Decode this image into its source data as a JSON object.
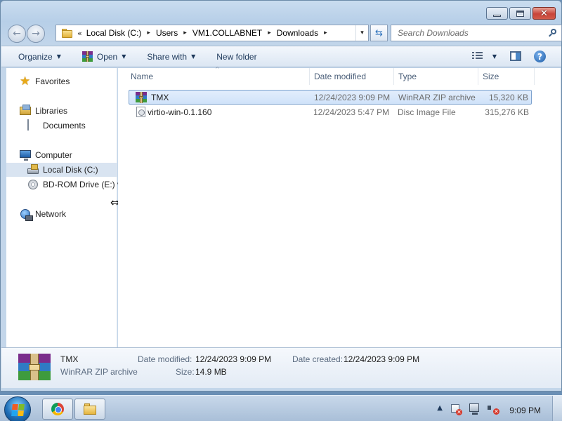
{
  "window": {
    "close_glyph": "✕"
  },
  "address": {
    "chevrons": "«",
    "crumbs": [
      "Local Disk (C:)",
      "Users",
      "VM1.COLLABNET",
      "Downloads"
    ],
    "sep": "▸",
    "dropdown": "▾",
    "refresh": "⇆",
    "search_placeholder": "Search Downloads"
  },
  "nav_buttons": {
    "back": "←",
    "forward": "→"
  },
  "commands": {
    "organize": "Organize",
    "open": "Open",
    "share_with": "Share with",
    "new_folder": "New folder",
    "dropdown_arrow": "▼",
    "help": "?"
  },
  "nav_pane": {
    "favorites": "Favorites",
    "libraries": "Libraries",
    "documents": "Documents",
    "computer": "Computer",
    "local_disk": "Local Disk (C:)",
    "bd_rom": "BD-ROM Drive (E:) v",
    "network": "Network",
    "star_glyph": "★",
    "resize_cursor": "⇔"
  },
  "columns": {
    "name": "Name",
    "date_modified": "Date modified",
    "type": "Type",
    "size": "Size",
    "sort_caret": "^"
  },
  "files": [
    {
      "name": "TMX",
      "date": "12/24/2023 9:09 PM",
      "type": "WinRAR ZIP archive",
      "size": "15,320 KB",
      "icon": "winrar-icon",
      "selected": true
    },
    {
      "name": "virtio-win-0.1.160",
      "date": "12/24/2023 5:47 PM",
      "type": "Disc Image File",
      "size": "315,276 KB",
      "icon": "disc-image-icon",
      "selected": false
    }
  ],
  "details": {
    "name": "TMX",
    "type": "WinRAR ZIP archive",
    "date_modified_label": "Date modified:",
    "date_modified": "12/24/2023 9:09 PM",
    "date_created_label": "Date created:",
    "date_created": "12/24/2023 9:09 PM",
    "size_label": "Size:",
    "size": "14.9 MB"
  },
  "taskbar": {
    "tray_up": "▲",
    "clock": "9:09 PM"
  },
  "colors": {
    "window_frame": "#c3d6ea",
    "selection": "#cfe2f9",
    "close_button": "#c8443a"
  }
}
